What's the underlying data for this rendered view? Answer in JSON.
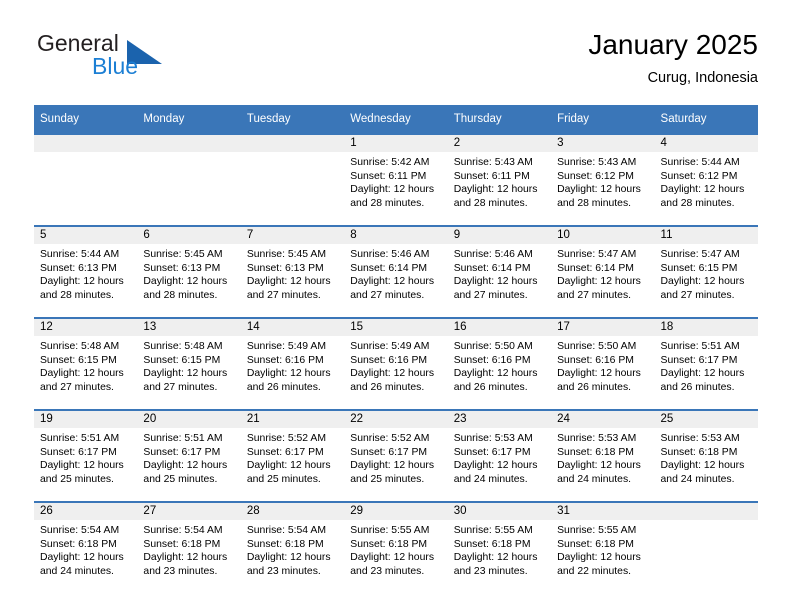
{
  "brand": {
    "name_line1": "General",
    "name_line2": "Blue",
    "triangle_color": "#1b63ad",
    "blue_color": "#1c7fd4"
  },
  "header": {
    "title": "January 2025",
    "subtitle": "Curug, Indonesia"
  },
  "theme": {
    "header_bg": "#3a76b8",
    "daynum_bg": "#efefef",
    "cell_bg": "#ffffff",
    "text": "#000000"
  },
  "weekday_headers": [
    "Sunday",
    "Monday",
    "Tuesday",
    "Wednesday",
    "Thursday",
    "Friday",
    "Saturday"
  ],
  "weeks": [
    [
      {
        "day": "",
        "sunrise": "",
        "sunset": "",
        "daylight_line1": "",
        "daylight_line2": "",
        "empty": true
      },
      {
        "day": "",
        "sunrise": "",
        "sunset": "",
        "daylight_line1": "",
        "daylight_line2": "",
        "empty": true
      },
      {
        "day": "",
        "sunrise": "",
        "sunset": "",
        "daylight_line1": "",
        "daylight_line2": "",
        "empty": true
      },
      {
        "day": "1",
        "sunrise": "Sunrise: 5:42 AM",
        "sunset": "Sunset: 6:11 PM",
        "daylight_line1": "Daylight: 12 hours",
        "daylight_line2": "and 28 minutes."
      },
      {
        "day": "2",
        "sunrise": "Sunrise: 5:43 AM",
        "sunset": "Sunset: 6:11 PM",
        "daylight_line1": "Daylight: 12 hours",
        "daylight_line2": "and 28 minutes."
      },
      {
        "day": "3",
        "sunrise": "Sunrise: 5:43 AM",
        "sunset": "Sunset: 6:12 PM",
        "daylight_line1": "Daylight: 12 hours",
        "daylight_line2": "and 28 minutes."
      },
      {
        "day": "4",
        "sunrise": "Sunrise: 5:44 AM",
        "sunset": "Sunset: 6:12 PM",
        "daylight_line1": "Daylight: 12 hours",
        "daylight_line2": "and 28 minutes."
      }
    ],
    [
      {
        "day": "5",
        "sunrise": "Sunrise: 5:44 AM",
        "sunset": "Sunset: 6:13 PM",
        "daylight_line1": "Daylight: 12 hours",
        "daylight_line2": "and 28 minutes."
      },
      {
        "day": "6",
        "sunrise": "Sunrise: 5:45 AM",
        "sunset": "Sunset: 6:13 PM",
        "daylight_line1": "Daylight: 12 hours",
        "daylight_line2": "and 28 minutes."
      },
      {
        "day": "7",
        "sunrise": "Sunrise: 5:45 AM",
        "sunset": "Sunset: 6:13 PM",
        "daylight_line1": "Daylight: 12 hours",
        "daylight_line2": "and 27 minutes."
      },
      {
        "day": "8",
        "sunrise": "Sunrise: 5:46 AM",
        "sunset": "Sunset: 6:14 PM",
        "daylight_line1": "Daylight: 12 hours",
        "daylight_line2": "and 27 minutes."
      },
      {
        "day": "9",
        "sunrise": "Sunrise: 5:46 AM",
        "sunset": "Sunset: 6:14 PM",
        "daylight_line1": "Daylight: 12 hours",
        "daylight_line2": "and 27 minutes."
      },
      {
        "day": "10",
        "sunrise": "Sunrise: 5:47 AM",
        "sunset": "Sunset: 6:14 PM",
        "daylight_line1": "Daylight: 12 hours",
        "daylight_line2": "and 27 minutes."
      },
      {
        "day": "11",
        "sunrise": "Sunrise: 5:47 AM",
        "sunset": "Sunset: 6:15 PM",
        "daylight_line1": "Daylight: 12 hours",
        "daylight_line2": "and 27 minutes."
      }
    ],
    [
      {
        "day": "12",
        "sunrise": "Sunrise: 5:48 AM",
        "sunset": "Sunset: 6:15 PM",
        "daylight_line1": "Daylight: 12 hours",
        "daylight_line2": "and 27 minutes."
      },
      {
        "day": "13",
        "sunrise": "Sunrise: 5:48 AM",
        "sunset": "Sunset: 6:15 PM",
        "daylight_line1": "Daylight: 12 hours",
        "daylight_line2": "and 27 minutes."
      },
      {
        "day": "14",
        "sunrise": "Sunrise: 5:49 AM",
        "sunset": "Sunset: 6:16 PM",
        "daylight_line1": "Daylight: 12 hours",
        "daylight_line2": "and 26 minutes."
      },
      {
        "day": "15",
        "sunrise": "Sunrise: 5:49 AM",
        "sunset": "Sunset: 6:16 PM",
        "daylight_line1": "Daylight: 12 hours",
        "daylight_line2": "and 26 minutes."
      },
      {
        "day": "16",
        "sunrise": "Sunrise: 5:50 AM",
        "sunset": "Sunset: 6:16 PM",
        "daylight_line1": "Daylight: 12 hours",
        "daylight_line2": "and 26 minutes."
      },
      {
        "day": "17",
        "sunrise": "Sunrise: 5:50 AM",
        "sunset": "Sunset: 6:16 PM",
        "daylight_line1": "Daylight: 12 hours",
        "daylight_line2": "and 26 minutes."
      },
      {
        "day": "18",
        "sunrise": "Sunrise: 5:51 AM",
        "sunset": "Sunset: 6:17 PM",
        "daylight_line1": "Daylight: 12 hours",
        "daylight_line2": "and 26 minutes."
      }
    ],
    [
      {
        "day": "19",
        "sunrise": "Sunrise: 5:51 AM",
        "sunset": "Sunset: 6:17 PM",
        "daylight_line1": "Daylight: 12 hours",
        "daylight_line2": "and 25 minutes."
      },
      {
        "day": "20",
        "sunrise": "Sunrise: 5:51 AM",
        "sunset": "Sunset: 6:17 PM",
        "daylight_line1": "Daylight: 12 hours",
        "daylight_line2": "and 25 minutes."
      },
      {
        "day": "21",
        "sunrise": "Sunrise: 5:52 AM",
        "sunset": "Sunset: 6:17 PM",
        "daylight_line1": "Daylight: 12 hours",
        "daylight_line2": "and 25 minutes."
      },
      {
        "day": "22",
        "sunrise": "Sunrise: 5:52 AM",
        "sunset": "Sunset: 6:17 PM",
        "daylight_line1": "Daylight: 12 hours",
        "daylight_line2": "and 25 minutes."
      },
      {
        "day": "23",
        "sunrise": "Sunrise: 5:53 AM",
        "sunset": "Sunset: 6:17 PM",
        "daylight_line1": "Daylight: 12 hours",
        "daylight_line2": "and 24 minutes."
      },
      {
        "day": "24",
        "sunrise": "Sunrise: 5:53 AM",
        "sunset": "Sunset: 6:18 PM",
        "daylight_line1": "Daylight: 12 hours",
        "daylight_line2": "and 24 minutes."
      },
      {
        "day": "25",
        "sunrise": "Sunrise: 5:53 AM",
        "sunset": "Sunset: 6:18 PM",
        "daylight_line1": "Daylight: 12 hours",
        "daylight_line2": "and 24 minutes."
      }
    ],
    [
      {
        "day": "26",
        "sunrise": "Sunrise: 5:54 AM",
        "sunset": "Sunset: 6:18 PM",
        "daylight_line1": "Daylight: 12 hours",
        "daylight_line2": "and 24 minutes."
      },
      {
        "day": "27",
        "sunrise": "Sunrise: 5:54 AM",
        "sunset": "Sunset: 6:18 PM",
        "daylight_line1": "Daylight: 12 hours",
        "daylight_line2": "and 23 minutes."
      },
      {
        "day": "28",
        "sunrise": "Sunrise: 5:54 AM",
        "sunset": "Sunset: 6:18 PM",
        "daylight_line1": "Daylight: 12 hours",
        "daylight_line2": "and 23 minutes."
      },
      {
        "day": "29",
        "sunrise": "Sunrise: 5:55 AM",
        "sunset": "Sunset: 6:18 PM",
        "daylight_line1": "Daylight: 12 hours",
        "daylight_line2": "and 23 minutes."
      },
      {
        "day": "30",
        "sunrise": "Sunrise: 5:55 AM",
        "sunset": "Sunset: 6:18 PM",
        "daylight_line1": "Daylight: 12 hours",
        "daylight_line2": "and 23 minutes."
      },
      {
        "day": "31",
        "sunrise": "Sunrise: 5:55 AM",
        "sunset": "Sunset: 6:18 PM",
        "daylight_line1": "Daylight: 12 hours",
        "daylight_line2": "and 22 minutes."
      },
      {
        "day": "",
        "sunrise": "",
        "sunset": "",
        "daylight_line1": "",
        "daylight_line2": "",
        "empty": true
      }
    ]
  ]
}
